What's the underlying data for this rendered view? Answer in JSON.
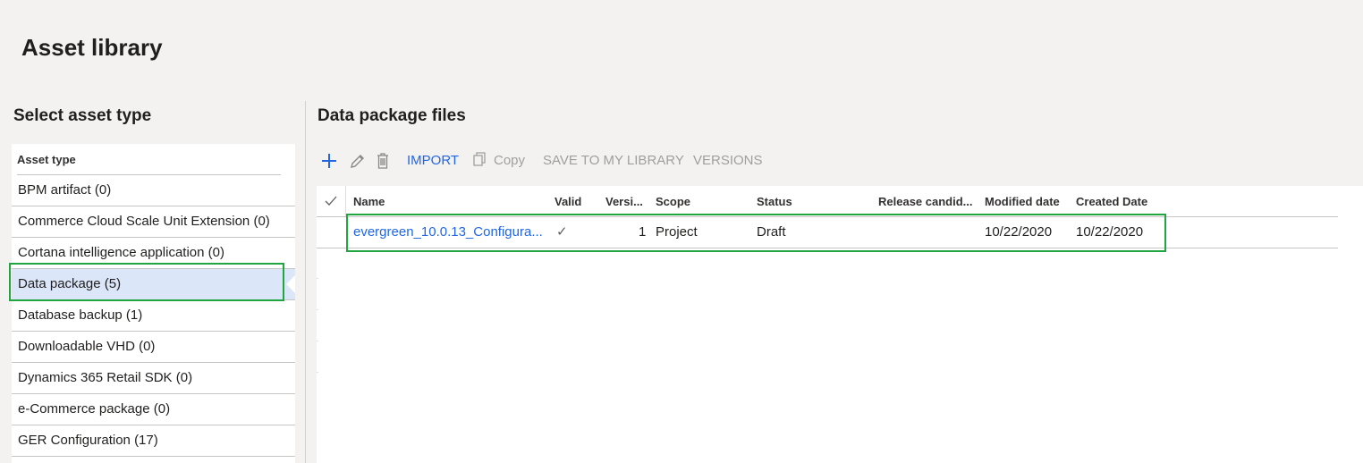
{
  "page": {
    "title": "Asset library"
  },
  "left": {
    "heading": "Select asset type",
    "column_header": "Asset type",
    "items": [
      {
        "label": "BPM artifact (0)"
      },
      {
        "label": "Commerce Cloud Scale Unit Extension (0)"
      },
      {
        "label": "Cortana intelligence application (0)"
      },
      {
        "label": "Data package (5)",
        "selected": true
      },
      {
        "label": "Database backup (1)"
      },
      {
        "label": "Downloadable VHD (0)"
      },
      {
        "label": "Dynamics 365 Retail SDK (0)"
      },
      {
        "label": "e-Commerce package (0)"
      },
      {
        "label": "GER Configuration (17)"
      }
    ]
  },
  "right": {
    "heading": "Data package files",
    "toolbar": {
      "add_icon": "plus-icon",
      "edit_icon": "pencil-icon",
      "delete_icon": "trash-icon",
      "import_label": "IMPORT",
      "copy_icon": "copy-icon",
      "copy_label": "Copy",
      "save_label": "SAVE TO MY LIBRARY",
      "versions_label": "VERSIONS"
    },
    "grid": {
      "headers": {
        "name": "Name",
        "valid": "Valid",
        "version": "Versi...",
        "scope": "Scope",
        "status": "Status",
        "release": "Release candid...",
        "modified": "Modified date",
        "created": "Created Date"
      },
      "rows": [
        {
          "name": "evergreen_10.0.13_Configura...",
          "valid": "✓",
          "version": "1",
          "scope": "Project",
          "status": "Draft",
          "release": "",
          "modified": "10/22/2020",
          "created": "10/22/2020"
        }
      ]
    }
  },
  "colors": {
    "accent": "#2266e3",
    "highlight": "#21a540",
    "selected_bg": "#dce6f9"
  }
}
